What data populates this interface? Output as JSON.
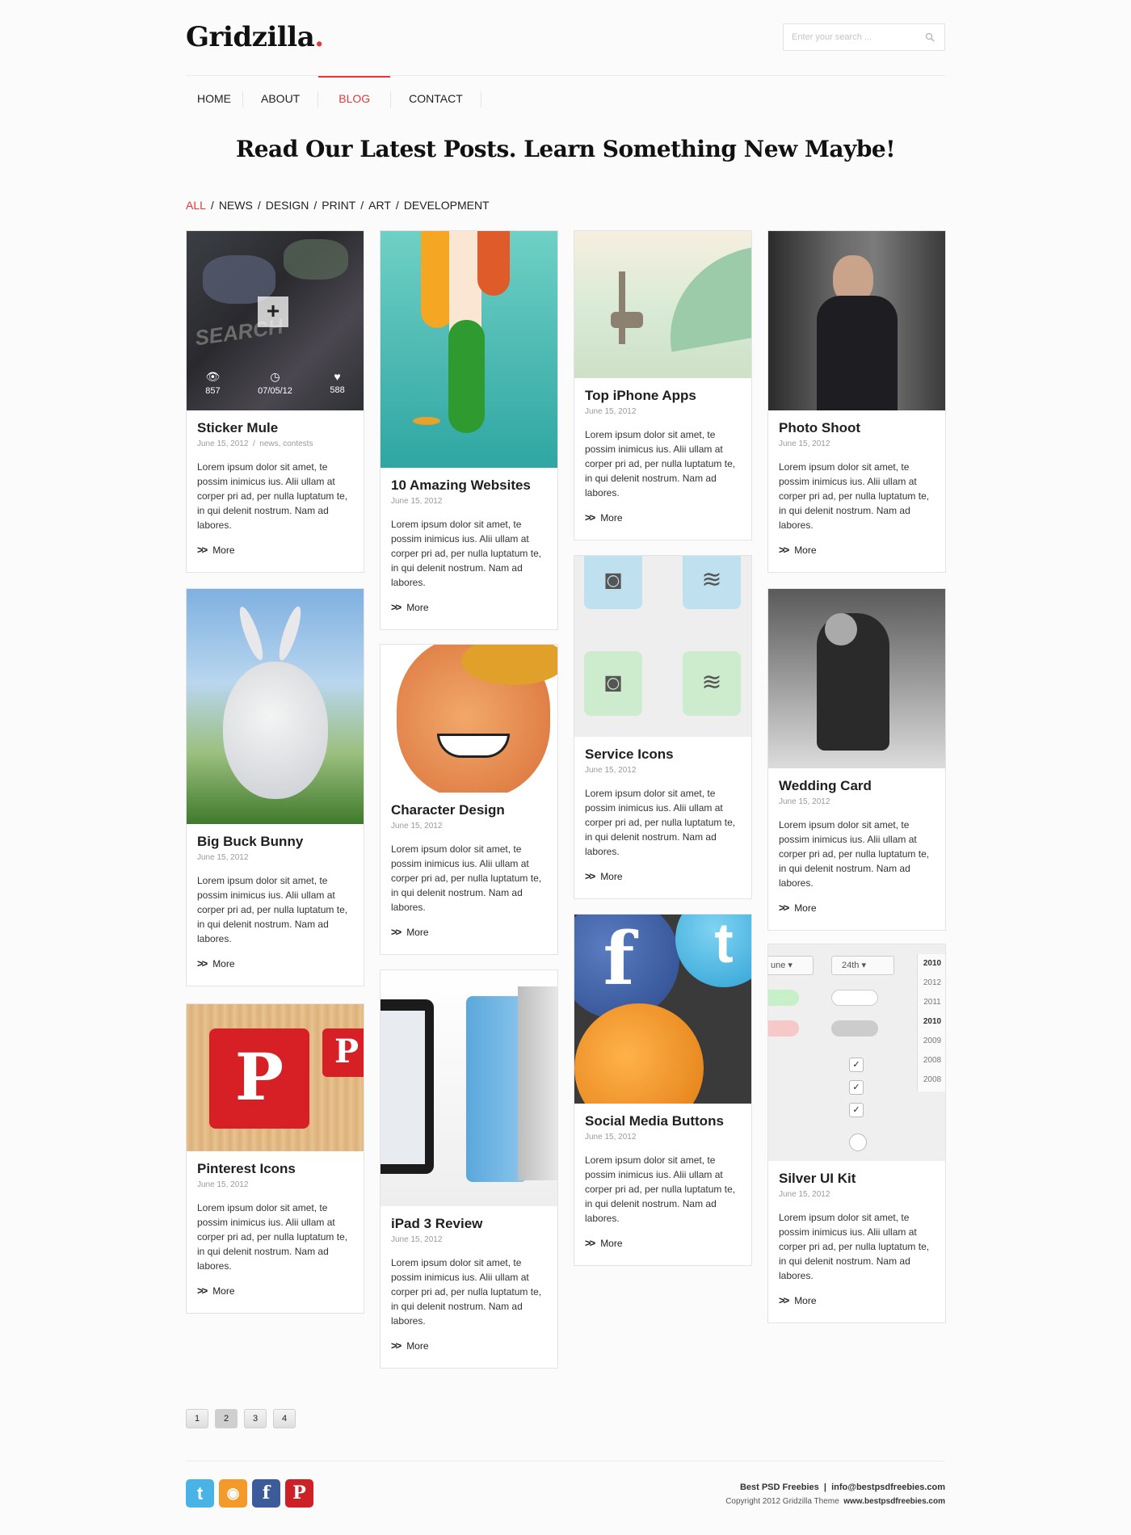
{
  "header": {
    "logo": "Gridzilla",
    "logo_dot": ".",
    "search_placeholder": "Enter your search ..."
  },
  "nav": [
    {
      "label": "HOME"
    },
    {
      "label": "ABOUT"
    },
    {
      "label": "BLOG",
      "active": true
    },
    {
      "label": "CONTACT"
    }
  ],
  "headline": "Read Our Latest Posts. Learn Something New Maybe!",
  "filters": [
    "ALL",
    "NEWS",
    "DESIGN",
    "PRINT",
    "ART",
    "DEVELOPMENT"
  ],
  "more_label": "More",
  "lorem": "Lorem ipsum dolor sit amet, te possim inimicus ius. Alii ullam at corper pri ad, per nulla luptatum te, in qui delenit nostrum. Nam ad labores.",
  "posts": [
    {
      "title": "Sticker Mule",
      "date": "June 15, 2012",
      "tags": "news, contests",
      "views": "857",
      "posted": "07/05/12",
      "likes": "588"
    },
    {
      "title": "10 Amazing Websites",
      "date": "June 15, 2012"
    },
    {
      "title": "Top iPhone Apps",
      "date": "June 15, 2012"
    },
    {
      "title": "Photo Shoot",
      "date": "June 15, 2012"
    },
    {
      "title": "Big Buck Bunny",
      "date": "June 15, 2012"
    },
    {
      "title": "Character Design",
      "date": "June 15, 2012"
    },
    {
      "title": "Service Icons",
      "date": "June 15, 2012"
    },
    {
      "title": "Wedding Card",
      "date": "June 15, 2012"
    },
    {
      "title": "Pinterest Icons",
      "date": "June 15, 2012"
    },
    {
      "title": "iPad 3 Review",
      "date": "June 15, 2012"
    },
    {
      "title": "Social Media Buttons",
      "date": "June 15, 2012"
    },
    {
      "title": "Silver UI Kit",
      "date": "June 15, 2012"
    }
  ],
  "image_labels": {
    "sticker": "SEARCH",
    "ui_month": "une",
    "ui_day": "24th",
    "ui_years": [
      "2010",
      "2012",
      "2011",
      "2010",
      "2009",
      "2008",
      "2008"
    ]
  },
  "pagination": [
    "1",
    "2",
    "3",
    "4"
  ],
  "footer": {
    "line1_left": "Best PSD Freebies",
    "line1_right": "info@bestpsdfreebies.com",
    "copyright": "Copyright 2012 Gridzilla Theme",
    "site": "www.bestpsdfreebies.com"
  },
  "colors": {
    "accent": "#e03a3a",
    "twitter": "#4ab3e6",
    "rss": "#f49a2a",
    "facebook": "#3b5b9a",
    "pinterest": "#cc2127"
  }
}
